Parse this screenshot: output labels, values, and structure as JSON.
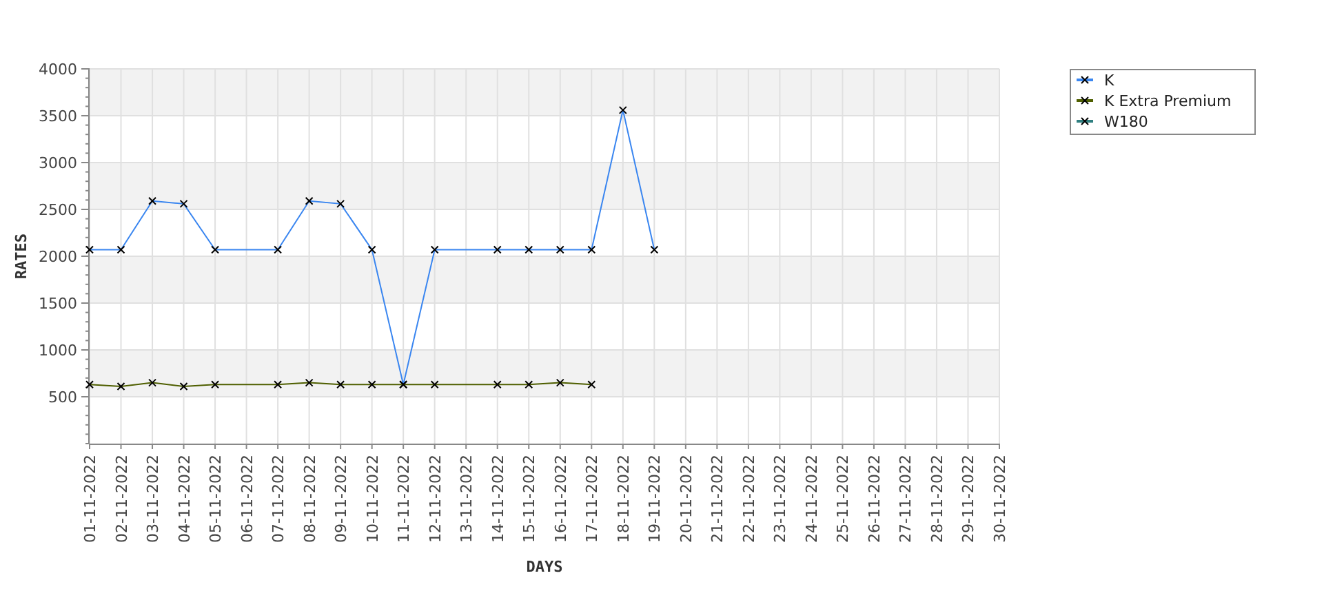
{
  "chart_data": {
    "type": "line",
    "xlabel": "DAYS",
    "ylabel": "RATES",
    "categories": [
      "01-11-2022",
      "02-11-2022",
      "03-11-2022",
      "04-11-2022",
      "05-11-2022",
      "06-11-2022",
      "07-11-2022",
      "08-11-2022",
      "09-11-2022",
      "10-11-2022",
      "11-11-2022",
      "12-11-2022",
      "13-11-2022",
      "14-11-2022",
      "15-11-2022",
      "16-11-2022",
      "17-11-2022",
      "18-11-2022",
      "19-11-2022",
      "20-11-2022",
      "21-11-2022",
      "22-11-2022",
      "23-11-2022",
      "24-11-2022",
      "25-11-2022",
      "26-11-2022",
      "27-11-2022",
      "28-11-2022",
      "29-11-2022",
      "30-11-2022"
    ],
    "series": [
      {
        "name": "K",
        "color": "#3a86f0",
        "marker": "x",
        "values": [
          2070,
          2070,
          2590,
          2560,
          2070,
          null,
          2070,
          2590,
          2560,
          2070,
          630,
          2070,
          null,
          2070,
          2070,
          2070,
          2070,
          3560,
          2070,
          null,
          null,
          null,
          null,
          null,
          null,
          null,
          null,
          null,
          null,
          null
        ]
      },
      {
        "name": "K Extra Premium",
        "color": "#4f5f00",
        "marker": "x",
        "values": [
          630,
          610,
          650,
          610,
          630,
          null,
          630,
          650,
          630,
          630,
          630,
          630,
          null,
          630,
          630,
          650,
          630,
          null,
          null,
          null,
          null,
          null,
          null,
          null,
          null,
          null,
          null,
          null,
          null,
          null
        ]
      },
      {
        "name": "W180",
        "color": "#2f7f80",
        "marker": "x",
        "values": [
          null,
          null,
          null,
          null,
          null,
          null,
          null,
          null,
          null,
          null,
          null,
          null,
          null,
          null,
          null,
          null,
          null,
          null,
          null,
          null,
          null,
          null,
          null,
          null,
          null,
          null,
          null,
          null,
          null,
          null
        ]
      }
    ],
    "grid": true,
    "legend": true,
    "ylim": [
      0,
      4000
    ],
    "yticks": [
      500,
      1000,
      1500,
      2000,
      2500,
      3000,
      3500,
      4000
    ]
  }
}
